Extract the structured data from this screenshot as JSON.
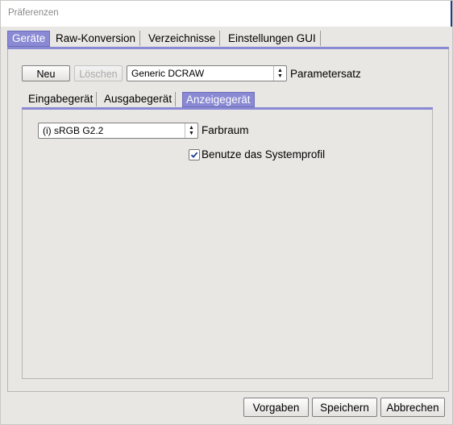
{
  "window": {
    "title": "Präferenzen"
  },
  "tabs": [
    {
      "label": "Geräte",
      "active": true
    },
    {
      "label": "Raw-Konversion",
      "active": false
    },
    {
      "label": "Verzeichnisse",
      "active": false
    },
    {
      "label": "Einstellungen GUI",
      "active": false
    }
  ],
  "toolbar": {
    "new_label": "Neu",
    "delete_label": "Löschen",
    "paramset_value": "Generic DCRAW",
    "paramset_label": "Parametersatz"
  },
  "subtabs": [
    {
      "label": "Eingabegerät",
      "active": false
    },
    {
      "label": "Ausgabegerät",
      "active": false
    },
    {
      "label": "Anzeigegerät",
      "active": true
    }
  ],
  "display": {
    "colorspace_value": "(i) sRGB G2.2",
    "colorspace_label": "Farbraum",
    "system_profile_label": "Benutze das Systemprofil",
    "system_profile_checked": true
  },
  "footer": {
    "defaults_label": "Vorgaben",
    "save_label": "Speichern",
    "cancel_label": "Abbrechen"
  },
  "colors": {
    "accent": "#8a89d3",
    "titlebar_accent": "#1f3a93"
  }
}
